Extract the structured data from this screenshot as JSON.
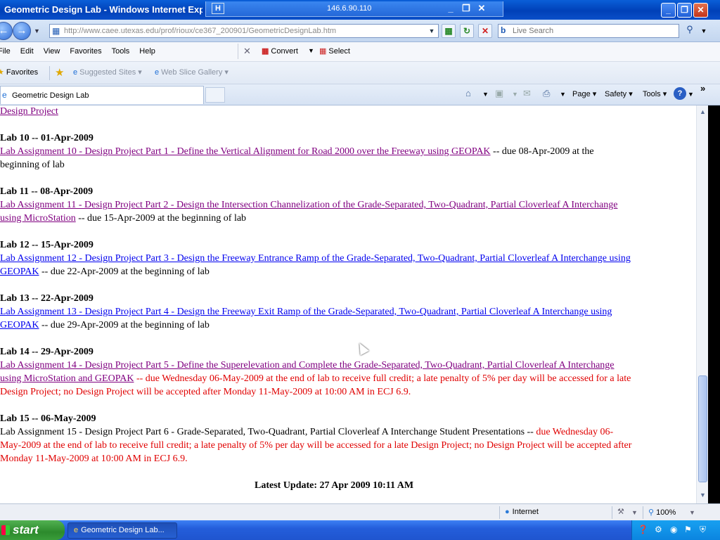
{
  "window": {
    "title": "Geometric Design Lab - Windows Internet Exp",
    "remote_host": "146.6.90.110",
    "remote_pin": "H",
    "remote_controls": [
      "_",
      "❐",
      "✕"
    ],
    "buttons": {
      "minimize": "_",
      "maximize": "❐",
      "close": "✕"
    }
  },
  "address_bar": {
    "url": "http://www.caee.utexas.edu/prof/rioux/ce367_200901/GeometricDesignLab.htm",
    "search_placeholder": "Live Search"
  },
  "menu": {
    "items": [
      "File",
      "Edit",
      "View",
      "Favorites",
      "Tools",
      "Help"
    ],
    "convert_label": "Convert",
    "select_label": "Select"
  },
  "favorites_bar": {
    "favorites_label": "Favorites",
    "suggested_sites": "Suggested Sites ▾",
    "web_slice_gallery": "Web Slice Gallery ▾"
  },
  "tab": {
    "label": "Geometric Design Lab"
  },
  "command_bar": {
    "page": "Page ▾",
    "safety": "Safety ▾",
    "tools": "Tools ▾",
    "help_icon": "?"
  },
  "content": {
    "top_link": "Design Project",
    "labs": [
      {
        "heading": "Lab 10 -- 01-Apr-2009",
        "link": "Lab Assignment 10 - Design Project Part 1 - Define the Vertical Alignment for Road 2000 over the Freeway using GEOPAK",
        "link_tail": "",
        "due": " -- due 08-Apr-2009 at the",
        "due_tail": "beginning of lab",
        "visited": true
      },
      {
        "heading": "Lab 11 -- 08-Apr-2009",
        "link": "Lab Assignment 11 - Design Project Part 2 - Design the Intersection Channelization of the Grade-Separated, Two-Quadrant, Partial Cloverleaf A Interchange",
        "link_tail": "using MicroStation",
        "due": " -- due 15-Apr-2009 at the beginning of lab",
        "visited": true
      },
      {
        "heading": "Lab 12 -- 15-Apr-2009",
        "link": "Lab Assignment 12 - Design Project Part 3 - Design the Freeway Entrance Ramp of the Grade-Separated, Two-Quadrant, Partial Cloverleaf A Interchange using",
        "link_tail": "GEOPAK",
        "due": " -- due 22-Apr-2009 at the beginning of lab",
        "visited": false
      },
      {
        "heading": "Lab 13 -- 22-Apr-2009",
        "link": "Lab Assignment 13 - Design Project Part 4 - Design the Freeway Exit Ramp of the Grade-Separated, Two-Quadrant, Partial Cloverleaf A Interchange using",
        "link_tail": "GEOPAK",
        "due": " -- due 29-Apr-2009 at the beginning of lab",
        "visited": false
      },
      {
        "heading": "Lab 14 -- 29-Apr-2009",
        "link": "Lab Assignment 14 - Design Project Part 5 - Define the Superelevation and Complete the Grade-Separated, Two-Quadrant, Partial Cloverleaf A Interchange",
        "link_tail": "using MicroStation and GEOPAK",
        "due_line1": " -- due Wednesday 06-May-2009 at the end of lab to receive full credit; a late penalty of 5% per day will be accessed for a late",
        "due_line2": "Design Project; no Design Project will be accepted after Monday 11-May-2009 at 10:00 AM in ECJ 6.9."
      },
      {
        "heading": "Lab 15 -- 06-May-2009",
        "text": "Lab Assignment 15 - Design Project Part 6 - Grade-Separated, Two-Quadrant, Partial Cloverleaf A Interchange Student Presentations -- ",
        "due_line1": "due Wednesday 06-",
        "due_line2": "May-2009 at the end of lab to receive full credit; a late penalty of 5% per day will be accessed for a late Design Project; no Design Project will be accepted after",
        "due_line3": "Monday 11-May-2009 at 10:00 AM in ECJ 6.9."
      }
    ],
    "latest_update": "Latest Update: 27 Apr 2009 10:11 AM"
  },
  "status_bar": {
    "zone": "Internet",
    "zoom": "100%"
  },
  "taskbar": {
    "start": "start",
    "task_item": "Geometric Design Lab..."
  }
}
